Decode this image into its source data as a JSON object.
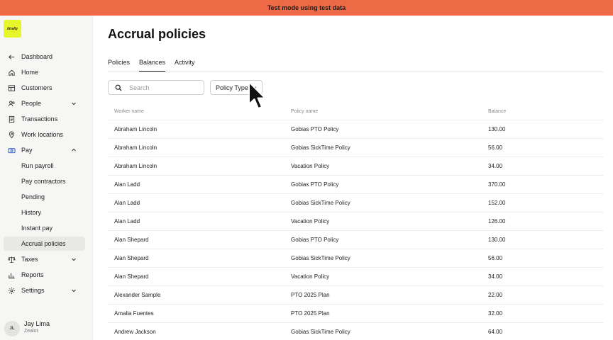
{
  "banner": {
    "text": "Test mode using test data"
  },
  "logo": {
    "text": "ittrally"
  },
  "sidebar": {
    "items": [
      {
        "label": "Dashboard",
        "icon": "arrow-left-icon"
      },
      {
        "label": "Home",
        "icon": "home-icon"
      },
      {
        "label": "Customers",
        "icon": "building-icon"
      },
      {
        "label": "People",
        "icon": "people-icon",
        "expandable": true
      },
      {
        "label": "Transactions",
        "icon": "receipt-icon"
      },
      {
        "label": "Work locations",
        "icon": "location-pin-icon"
      },
      {
        "label": "Pay",
        "icon": "money-icon",
        "expandable": true,
        "expanded": true
      }
    ],
    "pay_subitems": [
      {
        "label": "Run payroll"
      },
      {
        "label": "Pay contractors"
      },
      {
        "label": "Pending"
      },
      {
        "label": "History"
      },
      {
        "label": "Instant pay"
      },
      {
        "label": "Accrual policies",
        "active": true
      }
    ],
    "bottom_items": [
      {
        "label": "Taxes",
        "icon": "scale-icon",
        "expandable": true
      },
      {
        "label": "Reports",
        "icon": "chart-icon"
      },
      {
        "label": "Settings",
        "icon": "gear-icon",
        "expandable": true
      }
    ]
  },
  "user": {
    "initials": "JL",
    "name": "Jay Lima",
    "role": "Zealot"
  },
  "page": {
    "title": "Accrual policies"
  },
  "tabs": [
    {
      "label": "Policies"
    },
    {
      "label": "Balances",
      "active": true
    },
    {
      "label": "Activity"
    }
  ],
  "search": {
    "placeholder": "Search"
  },
  "filter": {
    "label": "Policy Type"
  },
  "table": {
    "headers": {
      "worker": "Worker name",
      "policy": "Policy name",
      "balance": "Balance"
    },
    "rows": [
      {
        "worker": "Abraham Lincoln",
        "policy": "Gobias PTO Policy",
        "balance": "130.00"
      },
      {
        "worker": "Abraham Lincoln",
        "policy": "Gobias SickTime Policy",
        "balance": "56.00"
      },
      {
        "worker": "Abraham Lincoln",
        "policy": "Vacation Policy",
        "balance": "34.00"
      },
      {
        "worker": "Alan Ladd",
        "policy": "Gobias PTO Policy",
        "balance": "370.00"
      },
      {
        "worker": "Alan Ladd",
        "policy": "Gobias SickTime Policy",
        "balance": "152.00"
      },
      {
        "worker": "Alan Ladd",
        "policy": "Vacation Policy",
        "balance": "126.00"
      },
      {
        "worker": "Alan Shepard",
        "policy": "Gobias PTO Policy",
        "balance": "130.00"
      },
      {
        "worker": "Alan Shepard",
        "policy": "Gobias SickTime Policy",
        "balance": "56.00"
      },
      {
        "worker": "Alan Shepard",
        "policy": "Vacation Policy",
        "balance": "34.00"
      },
      {
        "worker": "Alexander Sample",
        "policy": "PTO 2025 Plan",
        "balance": "22.00"
      },
      {
        "worker": "Amalia Fuentes",
        "policy": "PTO 2025 Plan",
        "balance": "32.00"
      },
      {
        "worker": "Andrew Jackson",
        "policy": "Gobias SickTime Policy",
        "balance": "64.00"
      }
    ]
  },
  "colors": {
    "banner": "#ee6a47",
    "logo": "#e6f62a",
    "sidebar": "#f6f6f5"
  }
}
